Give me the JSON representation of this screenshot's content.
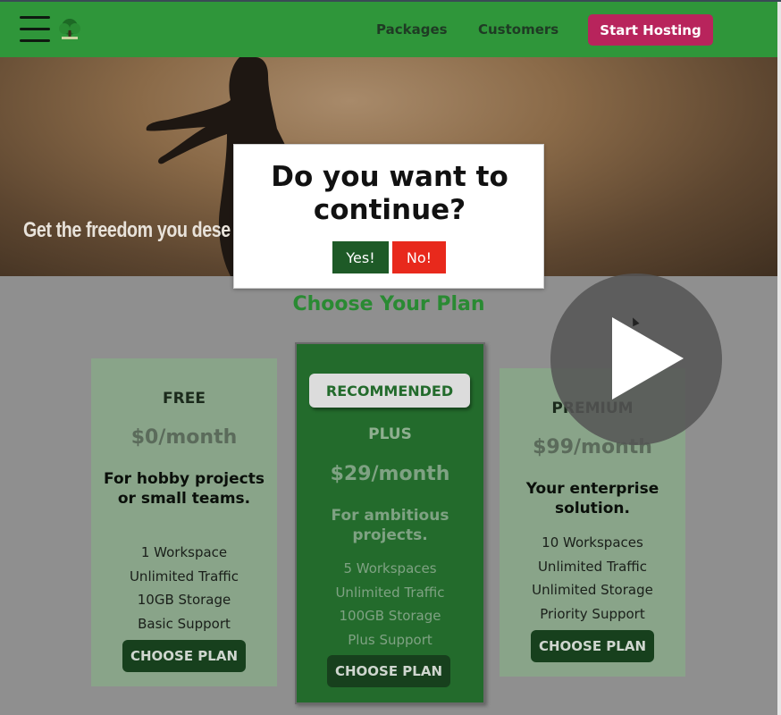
{
  "header": {
    "nav": {
      "packages": "Packages",
      "customers": "Customers"
    },
    "cta_label": "Start Hosting",
    "logo_icon": "tree-logo-icon"
  },
  "hero": {
    "tagline": "Get the freedom you dese"
  },
  "plans_section": {
    "title": "Choose Your Plan"
  },
  "plans": [
    {
      "name": "FREE",
      "price": "$0/month",
      "description": "For hobby projects or small teams.",
      "features": [
        "1 Workspace",
        "Unlimited Traffic",
        "10GB Storage",
        "Basic Support"
      ],
      "button": "CHOOSE PLAN"
    },
    {
      "badge": "RECOMMENDED",
      "name": "PLUS",
      "price": "$29/month",
      "description": "For ambitious projects.",
      "features": [
        "5 Workspaces",
        "Unlimited Traffic",
        "100GB Storage",
        "Plus Support"
      ],
      "button": "CHOOSE PLAN"
    },
    {
      "name": "PREMIUM",
      "price": "$99/month",
      "description": "Your enterprise solution.",
      "features": [
        "10 Workspaces",
        "Unlimited Traffic",
        "Unlimited Storage",
        "Priority Support"
      ],
      "button": "CHOOSE PLAN"
    }
  ],
  "dialog": {
    "title": "Do you want to continue?",
    "yes_label": "Yes!",
    "no_label": "No!"
  },
  "colors": {
    "header_bg": "#2f963a",
    "cta_bg": "#b8245c",
    "accent_green": "#2a8a33",
    "yes_bg": "#1e5a27",
    "no_bg": "#e8291c"
  }
}
